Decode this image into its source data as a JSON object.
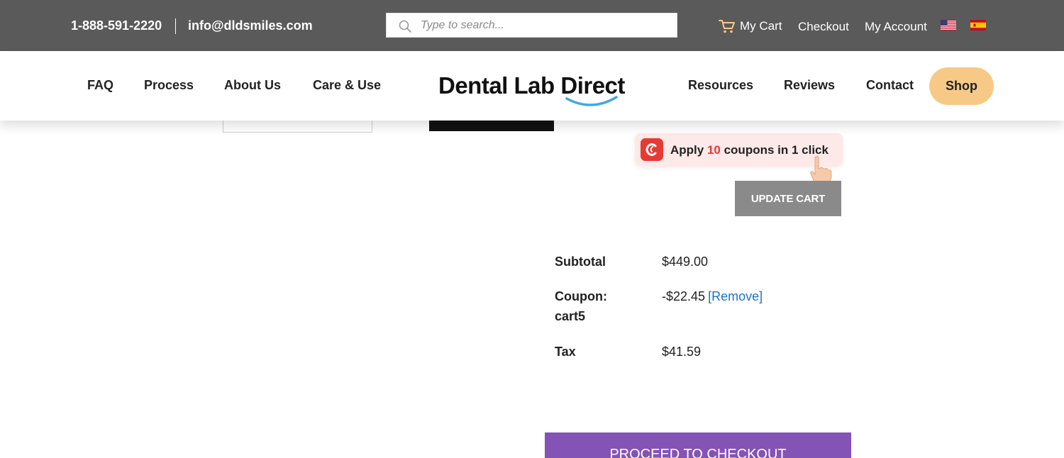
{
  "topbar": {
    "phone": "1-888-591-2220",
    "email": "info@dldsmiles.com",
    "search_placeholder": "Type to search...",
    "cart_label": "My Cart",
    "checkout_label": "Checkout",
    "account_label": "My Account"
  },
  "nav": {
    "left": [
      "FAQ",
      "Process",
      "About Us",
      "Care & Use"
    ],
    "logo_text": "Dental Lab Direct",
    "right": [
      "Resources",
      "Reviews",
      "Contact"
    ],
    "shop_label": "Shop"
  },
  "coupon_widget": {
    "prefix": "Apply ",
    "count": "10",
    "suffix": " coupons in 1 click",
    "accent": "#e63a34"
  },
  "cart": {
    "update_label": "UPDATE CART",
    "totals": {
      "subtotal_label": "Subtotal",
      "subtotal_value": "$449.00",
      "coupon_label_line1": "Coupon:",
      "coupon_label_line2": "cart5",
      "coupon_value": "-$22.45",
      "remove_label": "[Remove]",
      "tax_label": "Tax",
      "tax_value": "$41.59"
    },
    "proceed_label": "PROCEED TO CHECKOUT"
  },
  "colors": {
    "topbar_bg": "#5a5a5a",
    "shop_button": "#f7c986",
    "update_button": "#8a8a8a",
    "checkout_button": "#8453b6",
    "link": "#1a73c9"
  }
}
